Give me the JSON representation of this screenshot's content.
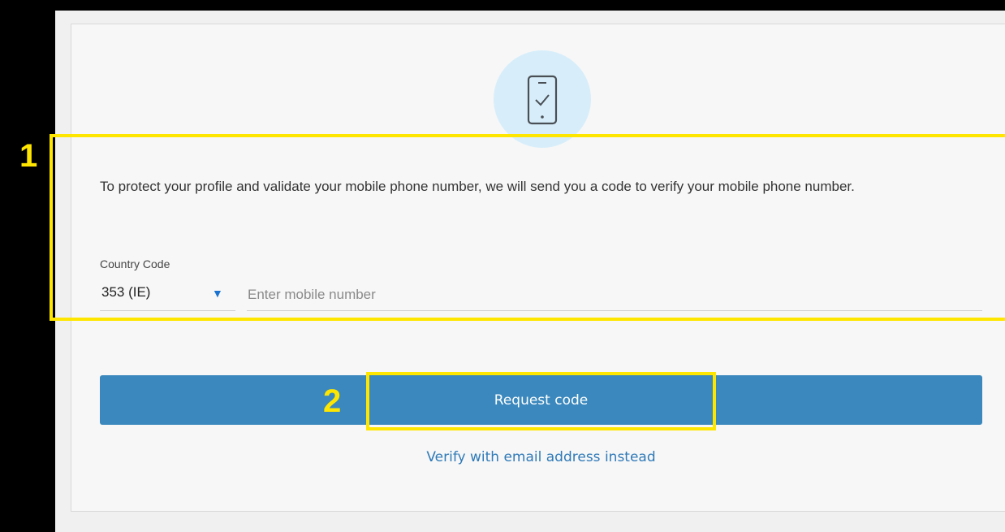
{
  "card": {
    "icon": "phone-check-icon",
    "description": "To protect your profile and validate your mobile phone number, we will send you a code to verify your mobile phone number.",
    "country_code_label": "Country Code",
    "country_code_value": "353 (IE)",
    "mobile_placeholder": "Enter mobile number",
    "request_button_label": "Request code",
    "email_link_label": "Verify with email address instead"
  },
  "annotations": {
    "step_1": "1",
    "step_2": "2",
    "highlight_color": "#ffe600"
  },
  "colors": {
    "primary_button": "#3a88bd",
    "link": "#2f7ab8",
    "icon_circle": "#d7eefa",
    "caret": "#1a73d1"
  }
}
